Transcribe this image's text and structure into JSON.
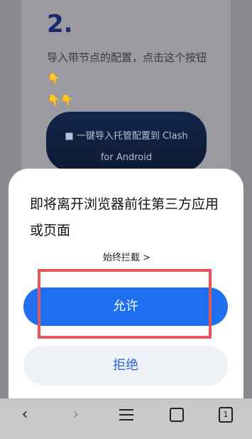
{
  "background_page": {
    "step_number": "2.",
    "step_text": "导入带节点的配置，点击这个按钮",
    "hand_emoji_1": "👇",
    "hand_emoji_2": "👇👇",
    "import_button_line1": "一键导入托管配置到 Clash",
    "import_button_line2": "for Android",
    "import_icon": "android-icon"
  },
  "dialog": {
    "title": "即将离开浏览器前往第三方应用或页面",
    "always_block_label": "始终拦截 >",
    "allow_label": "允许",
    "deny_label": "拒绝",
    "colors": {
      "allow_bg": "#1f6ff0",
      "deny_bg": "#eef1f6",
      "deny_text": "#2a67d6",
      "highlight": "#e3575c"
    }
  },
  "bottom_bar": {
    "back_icon": "back-chevron-icon",
    "forward_icon": "forward-chevron-icon",
    "menu_icon": "menu-icon",
    "home_icon": "home-square-icon",
    "tabs_count": "1"
  }
}
